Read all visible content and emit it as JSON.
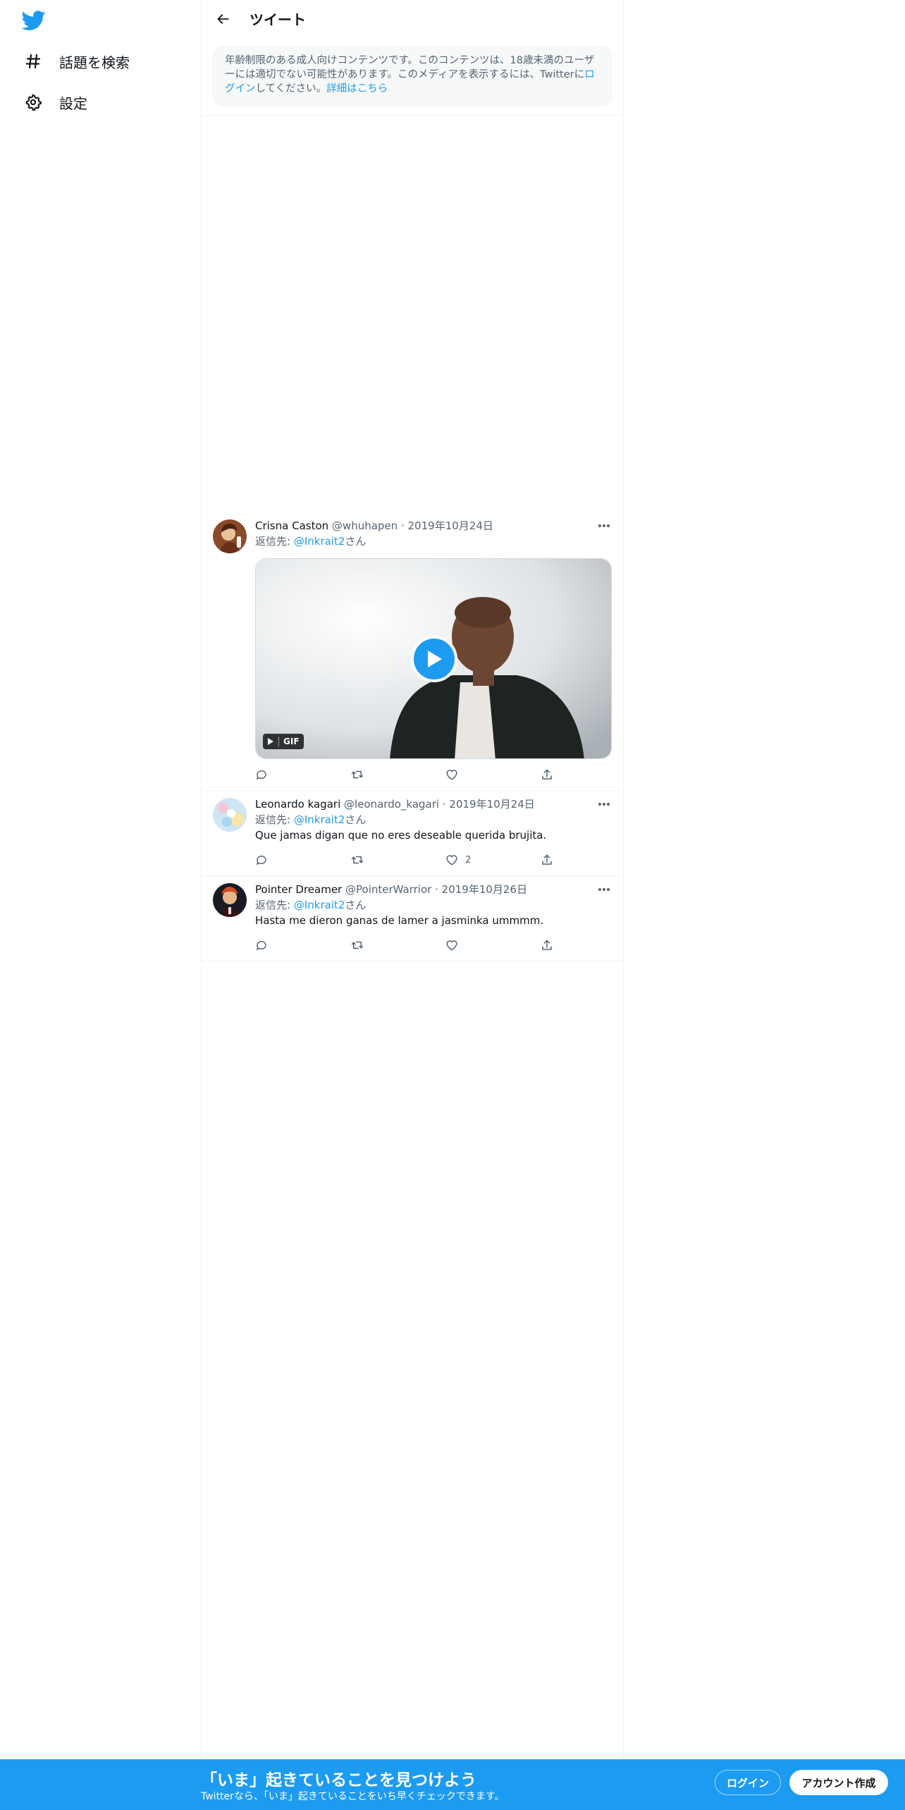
{
  "nav": {
    "logo_icon": "twitter-bird-icon",
    "items": [
      {
        "icon": "hashtag-icon",
        "label": "話題を検索"
      },
      {
        "icon": "gear-icon",
        "label": "設定"
      }
    ]
  },
  "header": {
    "back_icon": "arrow-left-icon",
    "title": "ツイート"
  },
  "notice": {
    "text_before": "年齢制限のある成人向けコンテンツです。このコンテンツは、18歳未満のユーザーには適切でない可能性があります。このメディアを表示するには、Twitterに",
    "login_link": "ログイン",
    "text_middle": "してください。",
    "details_link": "詳細はこちら"
  },
  "tweets": [
    {
      "name": "Crisna Caston",
      "handle": "@whuhapen",
      "date": "2019年10月24日",
      "reply_prefix": "返信先: ",
      "reply_to": "@Inkrait2",
      "reply_suffix": "さん",
      "text": "",
      "media": {
        "type": "GIF",
        "badge": "GIF"
      },
      "likes": ""
    },
    {
      "name": "Leonardo kagari",
      "handle": "@leonardo_kagari",
      "date": "2019年10月24日",
      "reply_prefix": "返信先: ",
      "reply_to": "@Inkrait2",
      "reply_suffix": "さん",
      "text": "Que jamas digan que no eres deseable querida brujita.",
      "likes": "2"
    },
    {
      "name": "Pointer Dreamer",
      "handle": "@PointerWarrior",
      "date": "2019年10月26日",
      "reply_prefix": "返信先: ",
      "reply_to": "@Inkrait2",
      "reply_suffix": "さん",
      "text": "Hasta me dieron ganas de lamer a jasminka ummmm.",
      "likes": ""
    }
  ],
  "bottom_bar": {
    "title": "「いま」起きていることを見つけよう",
    "subtitle": "Twitterなら、「いま」起きていることをいち早くチェックできます。",
    "login_label": "ログイン",
    "signup_label": "アカウント作成"
  },
  "colors": {
    "accent": "#1d9bf0",
    "text": "#0f1419",
    "secondary": "#536471",
    "border": "#eff3f4"
  }
}
